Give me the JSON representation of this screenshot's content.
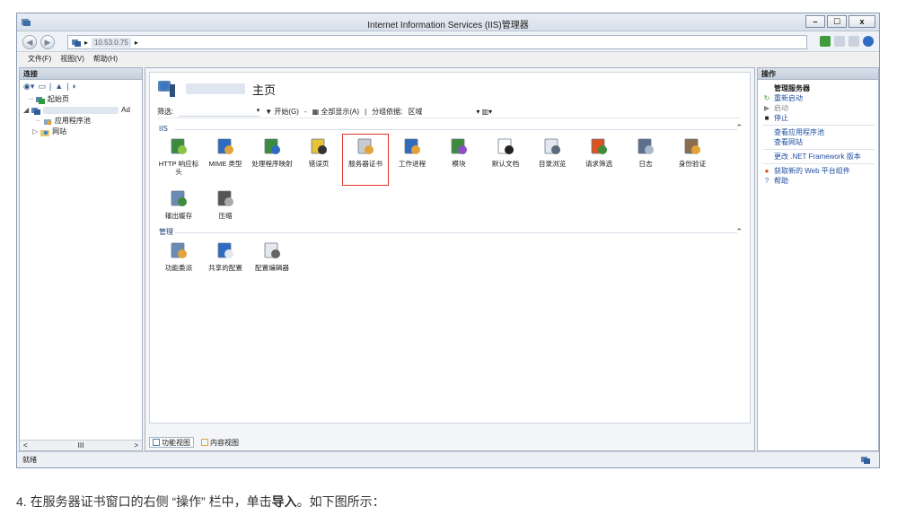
{
  "window": {
    "title": "Internet Information Services (IIS)管理器",
    "buttons": {
      "minimize": "–",
      "maximize": "☐",
      "close": "x"
    }
  },
  "address": {
    "segment": "10.53.0.75",
    "arrow": "▸"
  },
  "menu": [
    "文件(F)",
    "视图(V)",
    "帮助(H)"
  ],
  "connections": {
    "header": "连接",
    "tree": [
      {
        "label": "起始页",
        "indent": 1
      },
      {
        "label": "10.53.0.75 (10.53.0.75\\Ad",
        "indent": 0,
        "blurred": true,
        "suffix": "Ad"
      },
      {
        "label": "应用程序池",
        "indent": 2
      },
      {
        "label": "网站",
        "indent": 2
      }
    ],
    "scroll_label": "III"
  },
  "main": {
    "server": "10.53.0.75",
    "title": "主页",
    "filter": {
      "label": "筛选:",
      "start": "开始(G)",
      "show_all": "全部显示(A)",
      "group_by": "分组依据:",
      "group_value": "区域"
    },
    "groups": [
      {
        "name": "IIS",
        "features": [
          {
            "label": "HTTP 响应标头",
            "icon": "http-headers-icon"
          },
          {
            "label": "MIME 类型",
            "icon": "mime-icon"
          },
          {
            "label": "处理程序映射",
            "icon": "handler-icon"
          },
          {
            "label": "错误页",
            "icon": "error-page-icon"
          },
          {
            "label": "服务器证书",
            "icon": "certificate-icon",
            "selected": true
          },
          {
            "label": "工作进程",
            "icon": "worker-process-icon"
          },
          {
            "label": "模块",
            "icon": "modules-icon"
          },
          {
            "label": "默认文档",
            "icon": "default-doc-icon"
          },
          {
            "label": "目录浏览",
            "icon": "directory-icon"
          },
          {
            "label": "请求筛选",
            "icon": "request-filter-icon"
          },
          {
            "label": "日志",
            "icon": "logging-icon"
          },
          {
            "label": "身份验证",
            "icon": "auth-icon"
          },
          {
            "label": "输出缓存",
            "icon": "output-cache-icon"
          },
          {
            "label": "压缩",
            "icon": "compression-icon"
          }
        ]
      },
      {
        "name": "管理",
        "features": [
          {
            "label": "功能委派",
            "icon": "delegation-icon"
          },
          {
            "label": "共享的配置",
            "icon": "shared-config-icon"
          },
          {
            "label": "配置编辑器",
            "icon": "config-editor-icon"
          }
        ]
      }
    ],
    "tabs": {
      "features": "功能视图",
      "content": "内容视图"
    }
  },
  "actions": {
    "header": "操作",
    "section": "管理服务器",
    "items": [
      {
        "label": "重新启动",
        "icon": "restart-icon"
      },
      {
        "label": "启动",
        "icon": "start-icon",
        "disabled": true
      },
      {
        "label": "停止",
        "icon": "stop-icon"
      },
      {
        "label": "查看应用程序池",
        "icon": ""
      },
      {
        "label": "查看网站",
        "icon": ""
      },
      {
        "label": "更改 .NET Framework 版本",
        "icon": ""
      },
      {
        "label": "获取新的 Web 平台组件",
        "icon": "web-platform-icon"
      },
      {
        "label": "帮助",
        "icon": "help-icon"
      }
    ]
  },
  "status": "就绪",
  "caption": {
    "prefix": "4. 在服务器证书窗口的右侧 “操作” 栏中，单击",
    "bold": "导入",
    "suffix": "。如下图所示："
  }
}
